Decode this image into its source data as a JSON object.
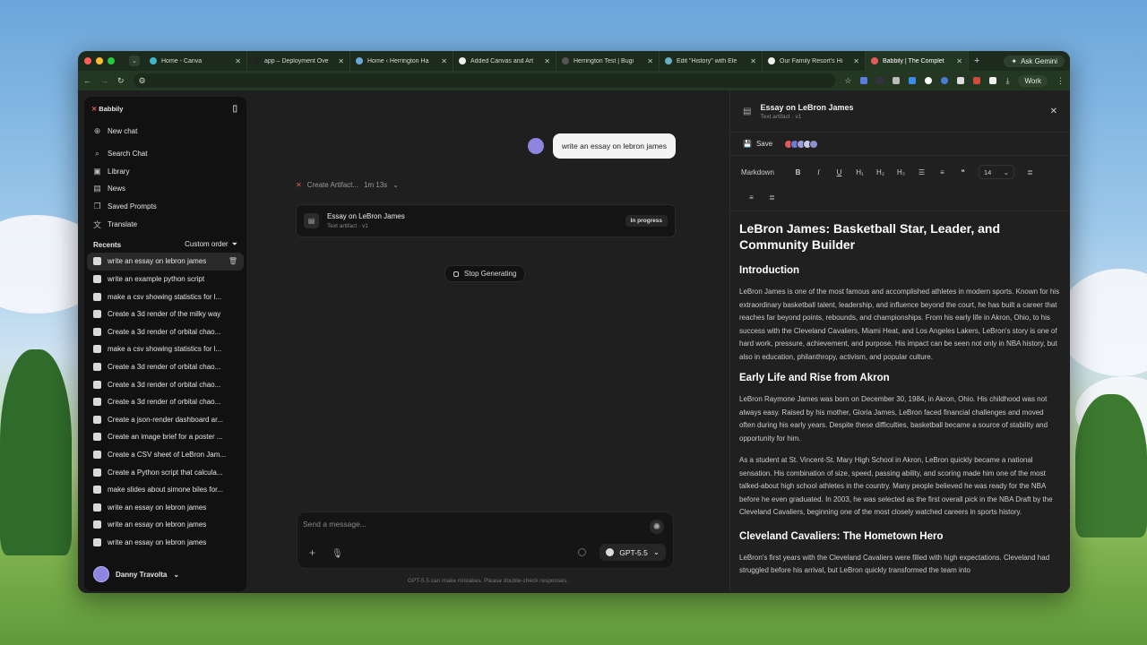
{
  "browser": {
    "tabs": [
      {
        "title": "Home - Canva",
        "color": "#3fb6c9"
      },
      {
        "title": "app – Deployment Ove",
        "color": "#222222"
      },
      {
        "title": "Home ‹ Herrington Ha",
        "color": "#6aa8d8"
      },
      {
        "title": "Added Canvas and Art",
        "color": "#eeeeee"
      },
      {
        "title": "Herrington Test | Bugi",
        "color": "#555555"
      },
      {
        "title": "Edit \"History\" with Ele",
        "color": "#66b0c0"
      },
      {
        "title": "Our Family Resort's Hi",
        "color": "#eeeeee"
      },
      {
        "title": "Babbily | The Complet",
        "color": "#e25a5a"
      }
    ],
    "ask_gemini": "Ask Gemini",
    "profile": "Work"
  },
  "sidebar": {
    "brand": "Babbily",
    "new_chat": "New chat",
    "nav": [
      {
        "label": "Search Chat",
        "icon": "search-icon"
      },
      {
        "label": "Library",
        "icon": "library-icon"
      },
      {
        "label": "News",
        "icon": "news-icon"
      },
      {
        "label": "Saved Prompts",
        "icon": "bookmark-icon"
      },
      {
        "label": "Translate",
        "icon": "translate-icon"
      }
    ],
    "recents_label": "Recents",
    "custom_order": "Custom order",
    "recents": [
      "write an essay on lebron james",
      "write an example python script",
      "make a csv showing statistics for l...",
      "Create a 3d render of the milky way",
      "Create a 3d render of orbital chao...",
      "make a csv showing statistics for l...",
      "Create a 3d render of orbital chao...",
      "Create a 3d render of orbital chao...",
      "Create a 3d render of orbital chao...",
      "Create a json-render dashboard ar...",
      "Create an image brief for a poster ...",
      "Create a CSV sheet of LeBron Jam...",
      "Create a Python script that calcula...",
      "make slides about simone biles for...",
      "write an essay on lebron james",
      "write an essay on lebron james",
      "write an essay on lebron james"
    ],
    "user": "Danny Travolta"
  },
  "chat": {
    "user_message": "write an essay on lebron james",
    "status_label": "Create Artifact...",
    "status_time": "1m 13s",
    "artifact_title": "Essay on LeBron James",
    "artifact_sub": "Text artifact · v1",
    "artifact_badge": "In progress",
    "stop": "Stop Generating",
    "placeholder": "Send a message...",
    "model": "GPT-5.5",
    "disclaimer": "GPT-5.5 can make mistakes. Please double-check responses."
  },
  "panel": {
    "title": "Essay on LeBron James",
    "subtitle": "Text artifact · v1",
    "save": "Save",
    "format": "Markdown",
    "tools": [
      "B",
      "I",
      "U",
      "H₁",
      "H₂",
      "H₃"
    ],
    "font_size": "14",
    "h1": "LeBron James: Basketball Star, Leader, and Community Builder",
    "sec1": "Introduction",
    "p1": "LeBron James is one of the most famous and accomplished athletes in modern sports. Known for his extraordinary basketball talent, leadership, and influence beyond the court, he has built a career that reaches far beyond points, rebounds, and championships. From his early life in Akron, Ohio, to his success with the Cleveland Cavaliers, Miami Heat, and Los Angeles Lakers, LeBron's story is one of hard work, pressure, achievement, and purpose. His impact can be seen not only in NBA history, but also in education, philanthropy, activism, and popular culture.",
    "sec2": "Early Life and Rise from Akron",
    "p2": "LeBron Raymone James was born on December 30, 1984, in Akron, Ohio. His childhood was not always easy. Raised by his mother, Gloria James, LeBron faced financial challenges and moved often during his early years. Despite these difficulties, basketball became a source of stability and opportunity for him.",
    "p3": "As a student at St. Vincent-St. Mary High School in Akron, LeBron quickly became a national sensation. His combination of size, speed, passing ability, and scoring made him one of the most talked-about high school athletes in the country. Many people believed he was ready for the NBA before he even graduated. In 2003, he was selected as the first overall pick in the NBA Draft by the Cleveland Cavaliers, beginning one of the most closely watched careers in sports history.",
    "sec3": "Cleveland Cavaliers: The Hometown Hero",
    "p4": "LeBron's first years with the Cleveland Cavaliers were filled with high expectations. Cleveland had struggled before his arrival, but LeBron quickly transformed the team into"
  }
}
